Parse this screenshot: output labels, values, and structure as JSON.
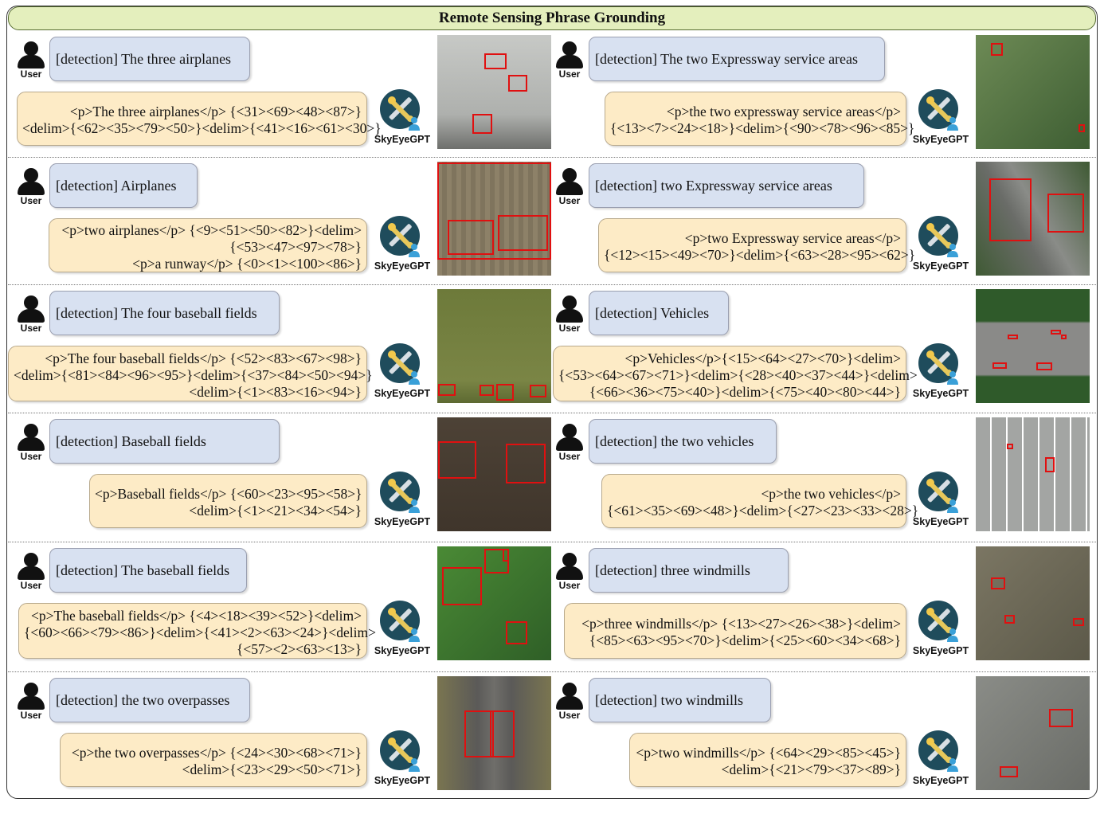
{
  "title": "Remote Sensing Phrase Grounding",
  "user_label": "User",
  "bot_label": "SkyEyeGPT",
  "left": [
    {
      "query": "[detection] The three airplanes",
      "answer": [
        "<p>The three airplanes</p> {<31><69><48><87>}",
        "<delim>{<62><35><79><50>}<delim>{<41><16><61><30>}"
      ]
    },
    {
      "query": "[detection] Airplanes",
      "answer": [
        "<p>two airplanes</p> {<9><51><50><82>}<delim>",
        "{<53><47><97><78>}",
        "<p>a runway</p> {<0><1><100><86>}"
      ]
    },
    {
      "query": "[detection] The four baseball fields",
      "answer": [
        "<p>The four baseball fields</p> {<52><83><67><98>}",
        "<delim>{<81><84><96><95>}<delim>{<37><84><50><94>}",
        "<delim>{<1><83><16><94>}"
      ]
    },
    {
      "query": "[detection] Baseball fields",
      "answer": [
        "<p>Baseball fields</p> {<60><23><95><58>}",
        "<delim>{<1><21><34><54>}"
      ]
    },
    {
      "query": "[detection] The baseball fields",
      "answer": [
        "<p>The baseball fields</p> {<4><18><39><52>}<delim>",
        "{<60><66><79><86>}<delim>{<41><2><63><24>}<delim>",
        "{<57><2><63><13>}"
      ]
    },
    {
      "query": "[detection] the two overpasses",
      "answer": [
        "<p>the two overpasses</p> {<24><30><68><71>}",
        "<delim>{<23><29><50><71>}"
      ]
    }
  ],
  "right": [
    {
      "query": "[detection] The two Expressway service areas",
      "answer": [
        "<p>the two expressway service areas</p>",
        "{<13><7><24><18>}<delim>{<90><78><96><85>}"
      ]
    },
    {
      "query": "[detection] two Expressway service areas",
      "answer": [
        "<p>two Expressway service areas</p>",
        "{<12><15><49><70>}<delim>{<63><28><95><62>}"
      ]
    },
    {
      "query": "[detection] Vehicles",
      "answer": [
        "<p>Vehicles</p>{<15><64><27><70>}<delim>",
        "{<53><64><67><71>}<delim>{<28><40><37><44>}<delim>",
        "{<66><36><75><40>}<delim>{<75><40><80><44>}"
      ]
    },
    {
      "query": "[detection] the two vehicles",
      "answer": [
        "<p>the two vehicles</p>",
        "{<61><35><69><48>}<delim>{<27><23><33><28>}"
      ]
    },
    {
      "query": "[detection] three windmills",
      "answer": [
        "<p>three windmills</p> {<13><27><26><38>}<delim>",
        "{<85><63><95><70>}<delim>{<25><60><34><68>}"
      ]
    },
    {
      "query": "[detection] two windmills",
      "answer": [
        "<p>two windmills</p> {<64><29><85><45>}",
        "<delim>{<21><79><37><89>}"
      ]
    }
  ]
}
